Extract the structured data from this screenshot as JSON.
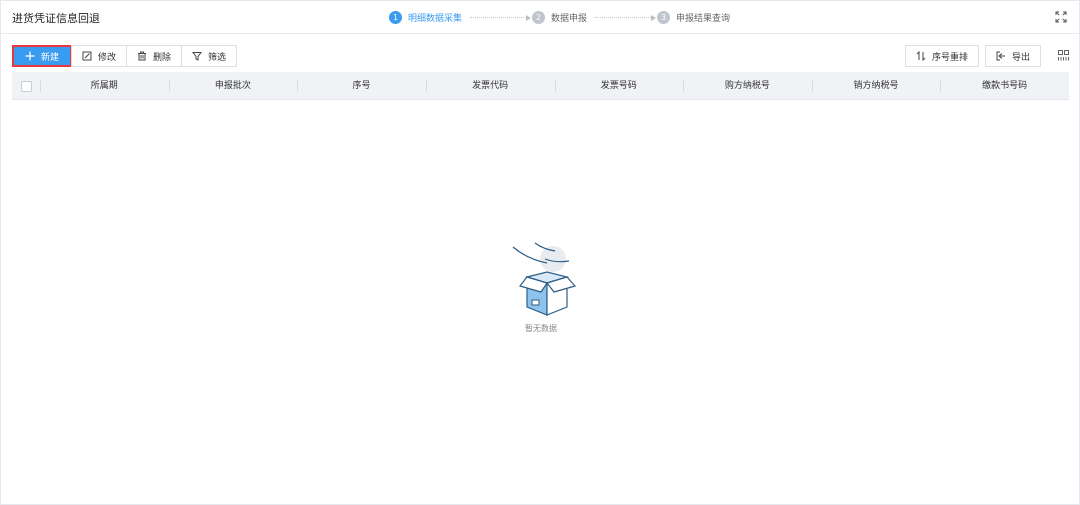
{
  "header": {
    "title": "进货凭证信息回退",
    "steps": [
      {
        "num": "1",
        "label": "明细数据采集"
      },
      {
        "num": "2",
        "label": "数据申报"
      },
      {
        "num": "3",
        "label": "申报结果查询"
      }
    ],
    "active_step": 1
  },
  "toolbar": {
    "new_label": "新建",
    "edit_label": "修改",
    "delete_label": "删除",
    "filter_label": "筛选",
    "reorder_label": "序号重排",
    "export_label": "导出"
  },
  "table": {
    "columns": [
      "所属期",
      "申报批次",
      "序号",
      "发票代码",
      "发票号码",
      "购方纳税号",
      "销方纳税号",
      "缴款书号码"
    ],
    "rows": []
  },
  "empty_state": {
    "text": "暂无数据"
  },
  "colors": {
    "accent": "#3a9cf0",
    "highlight_border": "#e8383d"
  },
  "icons": {
    "new": "plus-icon",
    "edit": "edit-icon",
    "delete": "trash-icon",
    "filter": "funnel-icon",
    "reorder": "sort-icon",
    "export": "export-icon",
    "fullscreen": "expand-icon",
    "columns": "grid-settings-icon",
    "empty": "empty-box-icon"
  }
}
